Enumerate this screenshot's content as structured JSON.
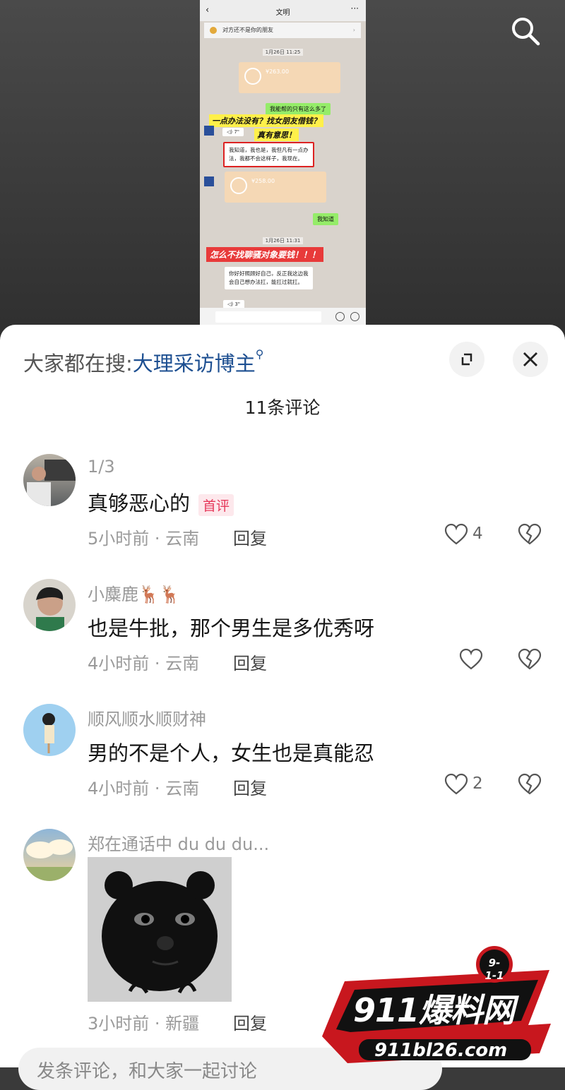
{
  "embedded_screenshot": {
    "chat_title": "文明",
    "notice": "对方还不是你的朋友",
    "time1": "1月26日 11:25",
    "transfer1": "¥263.00",
    "bubble_green1": "我能帮的只有这么多了",
    "caption_yellow1": "一点办法没有？找女朋友借钱？",
    "caption_yellow2": "真有意思！",
    "voice1": "◁) 7\"",
    "bubble_white1_line1": "我知道，我也是，我但凡有一点办",
    "bubble_white1_line2": "法，我都不会这样子，我现在。",
    "transfer2": "¥258.00",
    "bubble_green2": "我知道",
    "time2": "1月26日 11:31",
    "caption_red": "怎么不找聊骚对象要钱！！！",
    "bubble_white2_line1": "你好好照顾好自己，反正我这边我",
    "bubble_white2_line2": "会自己想办法扛，能扛过就扛。",
    "voice2": "◁) 3\""
  },
  "sheet": {
    "hot_search_prefix": "大家都在搜:",
    "hot_search_term": "大理采访博主",
    "comment_count_title": "11条评论"
  },
  "comments": [
    {
      "name": "1/3",
      "text": "真够恶心的",
      "badge": "首评",
      "meta": "5小时前 · 云南",
      "reply": "回复",
      "likes": "4"
    },
    {
      "name": "小麋鹿🦌🦌",
      "text": "也是牛批，那个男生是多优秀呀",
      "meta": "4小时前 · 云南",
      "reply": "回复",
      "likes": ""
    },
    {
      "name": "顺风顺水顺财神",
      "text": "男的不是个人，女生也是真能忍",
      "meta": "4小时前 · 云南",
      "reply": "回复",
      "likes": "2"
    },
    {
      "name": "郑在通话中 du du du...",
      "meta": "3小时前 · 新疆",
      "reply": "回复"
    }
  ],
  "input": {
    "placeholder": "发条评论，和大家一起讨论"
  },
  "watermark": {
    "badge": "9-1-1",
    "brand": "911爆料网",
    "url": "911bl26.com"
  },
  "colors": {
    "link": "#1d4f91",
    "badge": "#e6395b"
  }
}
